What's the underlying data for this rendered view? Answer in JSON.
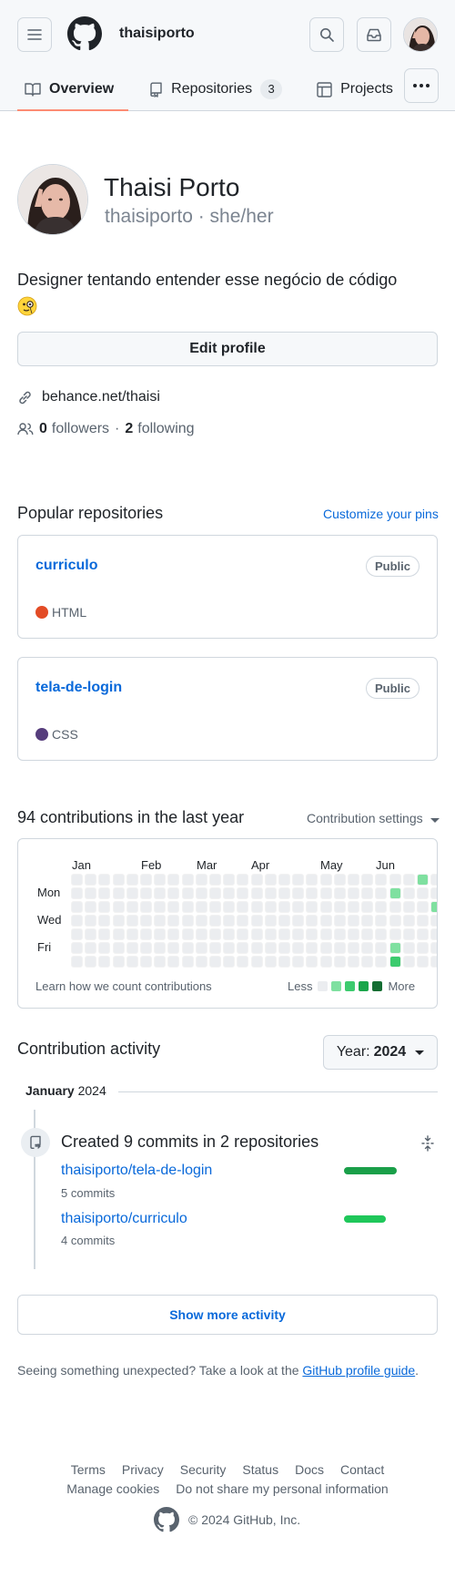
{
  "header": {
    "username": "thaisiporto"
  },
  "tabs": [
    {
      "label": "Overview",
      "active": true
    },
    {
      "label": "Repositories",
      "count": "3"
    },
    {
      "label": "Projects"
    }
  ],
  "profile": {
    "full_name": "Thaisi Porto",
    "subname": "thaisiporto · she/her",
    "bio": "Designer tentando entender esse negócio de código",
    "bio_emoji": "face-with-monocle-emoji",
    "edit_label": "Edit profile",
    "link": "behance.net/thaisi",
    "followers_count": "0",
    "followers_label": "followers",
    "separator": "·",
    "following_count": "2",
    "following_label": "following"
  },
  "pinned": {
    "title": "Popular repositories",
    "customize_label": "Customize your pins",
    "repos": [
      {
        "name": "curriculo",
        "visibility": "Public",
        "language": "HTML",
        "lang_color": "#e34c26"
      },
      {
        "name": "tela-de-login",
        "visibility": "Public",
        "language": "CSS",
        "lang_color": "#563d7c"
      }
    ]
  },
  "contributions": {
    "title": "94 contributions in the last year",
    "settings_label": "Contribution settings",
    "months": [
      "Jan",
      "Feb",
      "Mar",
      "Apr",
      "May",
      "Jun"
    ],
    "days": [
      "Mon",
      "Wed",
      "Fri"
    ],
    "learn_label": "Learn how we count contributions",
    "less_label": "Less",
    "more_label": "More",
    "colors": [
      "#ebedf0",
      "#7fe0a0",
      "#3ccb6e",
      "#1aa54a",
      "#146d32"
    ]
  },
  "activity": {
    "title": "Contribution activity",
    "year_prefix": "Year:",
    "year": "2024",
    "month_name": "January",
    "month_year": "2024",
    "summary": "Created 9 commits in 2 repositories",
    "repos": [
      {
        "name": "thaisiporto/tela-de-login",
        "commits": "5 commits",
        "share": 5
      },
      {
        "name": "thaisiporto/curriculo",
        "commits": "4 commits",
        "share": 4
      }
    ],
    "show_more_label": "Show more activity",
    "unexpected_text": "Seeing something unexpected? Take a look at the",
    "unexpected_link": "GitHub profile guide",
    "unexpected_end": "."
  },
  "footer": {
    "links_row1": [
      "Terms",
      "Privacy",
      "Security",
      "Status",
      "Docs",
      "Contact"
    ],
    "links_row2": [
      "Manage cookies",
      "Do not share my personal information"
    ],
    "copyright": "© 2024 GitHub, Inc."
  }
}
